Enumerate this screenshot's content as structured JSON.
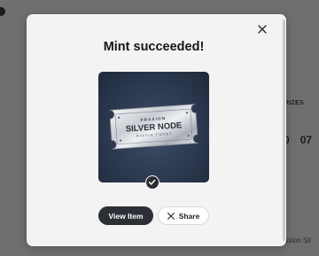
{
  "background": {
    "prizes_label": "RIZES",
    "countdown": [
      "0",
      "07"
    ],
    "item_name": "raxion Sil"
  },
  "modal": {
    "title": "Mint succeeded!",
    "nft": {
      "brand": "FRAXION",
      "name": "SILVER NODE",
      "subtitle": "RAFFLE TICKET"
    },
    "view_button": "View Item",
    "share_button": "Share",
    "share_icon": "x-logo-icon",
    "close_icon": "close-icon",
    "badge_icon": "check-icon"
  },
  "colors": {
    "overlay": "#6f6f70",
    "modal_bg": "#f3f3f4",
    "primary_button": "#2d2f36",
    "card_bg": "#2c394f"
  }
}
